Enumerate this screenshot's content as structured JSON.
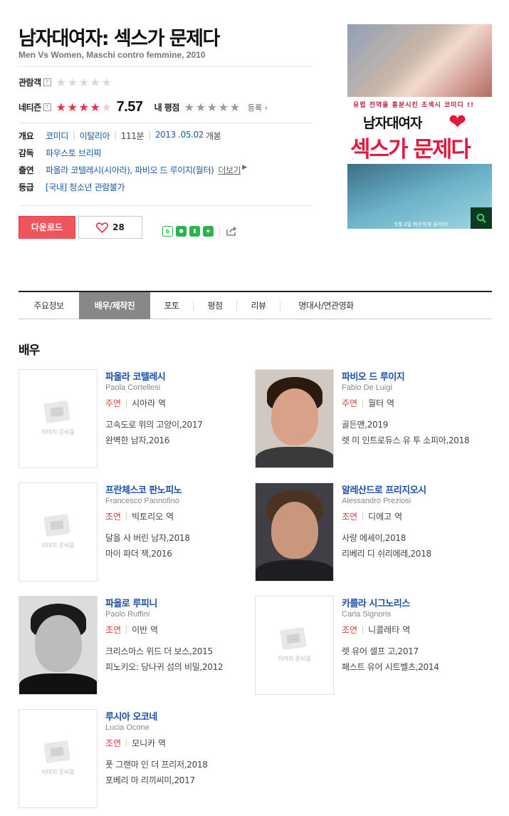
{
  "movie": {
    "title": "남자대여자: 섹스가 문제다",
    "subtitle": "Men Vs Women, Maschi contro femmine, 2010"
  },
  "ratings": {
    "audience_label": "관람객",
    "netizen_label": "네티즌",
    "help_mark": "?",
    "netizen_score": "7.57",
    "my_rating_label": "내 평점",
    "register_label": "등록",
    "register_chevron_icon": "chevron-right-icon"
  },
  "info": {
    "overview_label": "개요",
    "genre": "코미디",
    "country": "이탈리아",
    "runtime": "111분",
    "release_date": "2013 .05.02",
    "release_suffix": "개봉",
    "director_label": "감독",
    "director": "파우스토 브리찌",
    "cast_label": "출연",
    "cast": "파올라 코텔레시(시아라), 파비오 드 루이지(월터)",
    "cast_more": "더보기",
    "grade_label": "등급",
    "grade": "[국내] 청소년 관람불가"
  },
  "actions": {
    "download_label": "다운로드",
    "like_count": "28",
    "share_icons": [
      "blog-icon",
      "cafe-icon",
      "bookmark-icon",
      "memo-icon",
      "share-icon"
    ]
  },
  "poster": {
    "tagline": "유럽 전역을 흥분시킨 초섹시 코미디 !!",
    "title_line1": "남자대여자",
    "title_line2": "섹스가 문제다",
    "date_text": "5월 2일 화끈하게 즐겨라!"
  },
  "tabs": [
    "주요정보",
    "배우/제작진",
    "포토",
    "평점",
    "리뷰",
    "명대사/연관영화"
  ],
  "section_title": "배우",
  "placeholder_text": "이미지 준비중",
  "actors": [
    {
      "name": "파올라 코텔레시",
      "en": "Paola Cortellesi",
      "type": "주연",
      "role": "시아라 역",
      "films": [
        "고속도로 위의 고양이,2017",
        "완벽한 남자,2016"
      ]
    },
    {
      "name": "파비오 드 루이지",
      "en": "Fabio De Luigi",
      "type": "주연",
      "role": "월터 역",
      "films": [
        "골든맨,2019",
        "렛 미 인트로듀스 유 투 소피아,2018"
      ]
    },
    {
      "name": "프란체스코 판노피노",
      "en": "Francesco Pannofino",
      "type": "조연",
      "role": "빅토리오 역",
      "films": [
        "달을 사 버린 남자,2018",
        "마이 파더 잭,2016"
      ]
    },
    {
      "name": "알레산드로 프리지오시",
      "en": "Alessandro Preziosi",
      "type": "조연",
      "role": "디에고 역",
      "films": [
        "사랑 에세이,2018",
        "리베리 디 쉬리에레,2018"
      ]
    },
    {
      "name": "파올로 루피니",
      "en": "Paolo Ruffini",
      "type": "조연",
      "role": "이반 역",
      "films": [
        "크리스마스 위드 더 보스,2015",
        "피노키오: 당나귀 섬의 비밀,2012"
      ]
    },
    {
      "name": "카를라 시그노리스",
      "en": "Carla Signoris",
      "type": "조연",
      "role": "니콜레타 역",
      "films": [
        "렛 유어 셀프 고,2017",
        "패스트 유어 시트벨츠,2014"
      ]
    },
    {
      "name": "루시아 오코네",
      "en": "Lucia Ocone",
      "type": "조연",
      "role": "모니카 역",
      "films": [
        "풋 그랜마 인 더 프리저,2018",
        "포베리 마 리끼씨미,2017"
      ]
    }
  ]
}
